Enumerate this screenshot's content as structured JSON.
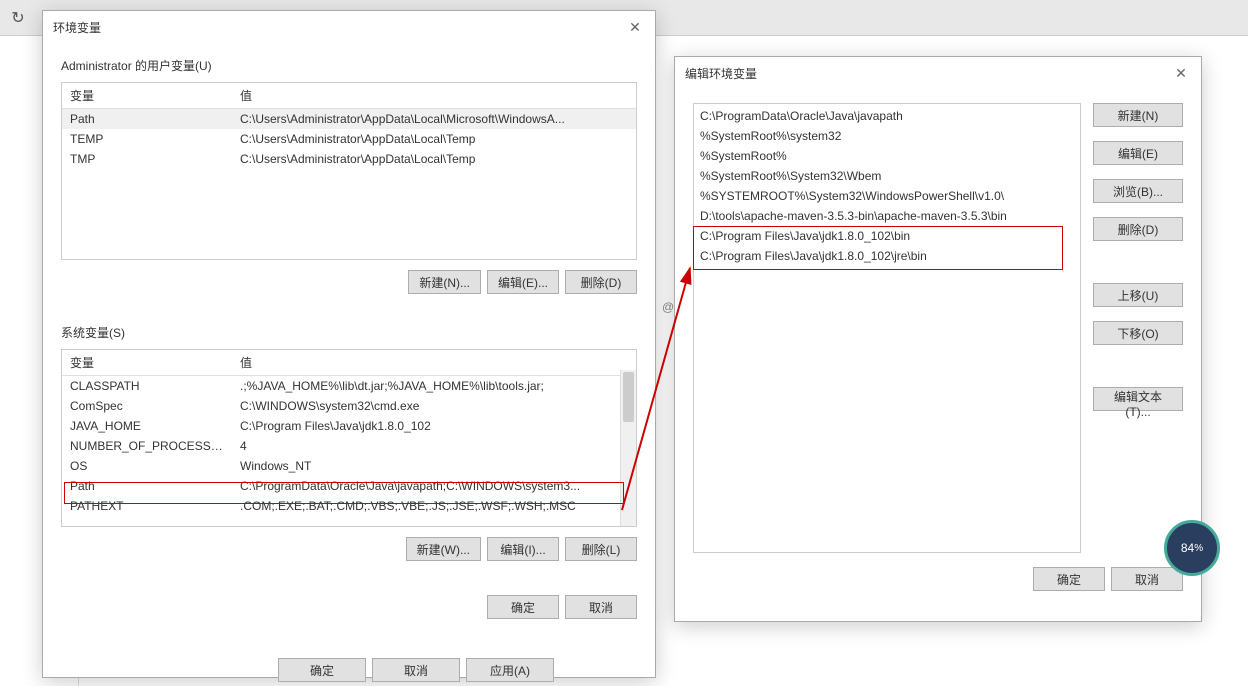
{
  "browser": {
    "refresh_icon": "↻"
  },
  "envDialog": {
    "title": "环境变量",
    "userGroup": "Administrator 的用户变量(U)",
    "headers": {
      "var": "变量",
      "val": "值"
    },
    "userVars": [
      {
        "name": "Path",
        "value": "C:\\Users\\Administrator\\AppData\\Local\\Microsoft\\WindowsA...",
        "selected": true
      },
      {
        "name": "TEMP",
        "value": "C:\\Users\\Administrator\\AppData\\Local\\Temp"
      },
      {
        "name": "TMP",
        "value": "C:\\Users\\Administrator\\AppData\\Local\\Temp"
      }
    ],
    "userButtons": {
      "new": "新建(N)...",
      "edit": "编辑(E)...",
      "delete": "删除(D)"
    },
    "sysGroup": "系统变量(S)",
    "sysVars": [
      {
        "name": "CLASSPATH",
        "value": ".;%JAVA_HOME%\\lib\\dt.jar;%JAVA_HOME%\\lib\\tools.jar;"
      },
      {
        "name": "ComSpec",
        "value": "C:\\WINDOWS\\system32\\cmd.exe"
      },
      {
        "name": "JAVA_HOME",
        "value": "C:\\Program Files\\Java\\jdk1.8.0_102"
      },
      {
        "name": "NUMBER_OF_PROCESSORS",
        "value": "4"
      },
      {
        "name": "OS",
        "value": "Windows_NT"
      },
      {
        "name": "Path",
        "value": "C:\\ProgramData\\Oracle\\Java\\javapath;C:\\WINDOWS\\system3..."
      },
      {
        "name": "PATHEXT",
        "value": ".COM;.EXE;.BAT;.CMD;.VBS;.VBE;.JS;.JSE;.WSF;.WSH;.MSC"
      }
    ],
    "sysButtons": {
      "new": "新建(W)...",
      "edit": "编辑(I)...",
      "delete": "删除(L)"
    },
    "footer": {
      "ok": "确定",
      "cancel": "取消"
    }
  },
  "editDialog": {
    "title": "编辑环境变量",
    "paths": [
      "C:\\ProgramData\\Oracle\\Java\\javapath",
      "%SystemRoot%\\system32",
      "%SystemRoot%",
      "%SystemRoot%\\System32\\Wbem",
      "%SYSTEMROOT%\\System32\\WindowsPowerShell\\v1.0\\",
      "D:\\tools\\apache-maven-3.5.3-bin\\apache-maven-3.5.3\\bin",
      "C:\\Program Files\\Java\\jdk1.8.0_102\\bin",
      "C:\\Program Files\\Java\\jdk1.8.0_102\\jre\\bin"
    ],
    "buttons": {
      "new": "新建(N)",
      "edit": "编辑(E)",
      "browse": "浏览(B)...",
      "delete": "删除(D)",
      "moveUp": "上移(U)",
      "moveDown": "下移(O)",
      "editText": "编辑文本(T)..."
    },
    "footer": {
      "ok": "确定",
      "cancel": "取消"
    }
  },
  "bottom": {
    "ok": "确定",
    "cancel": "取消",
    "apply": "应用(A)"
  },
  "at": "@",
  "badge": {
    "value": "84",
    "pct": "%"
  }
}
